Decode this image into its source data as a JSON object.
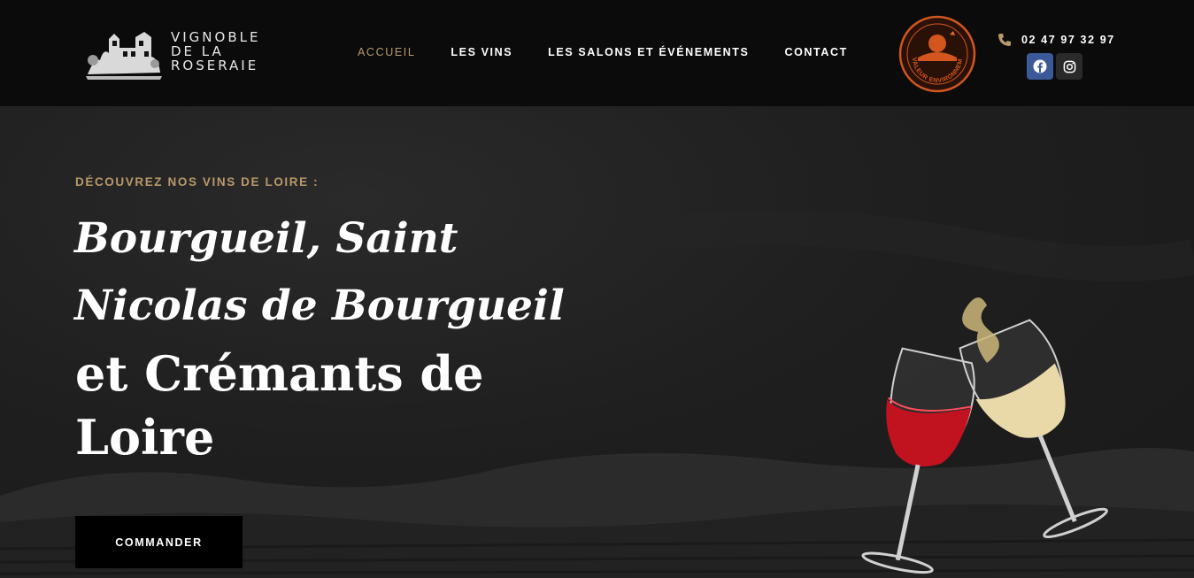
{
  "brand": {
    "name_lines": [
      "VIGNOBLE",
      "DE LA",
      "ROSERAIE"
    ],
    "logo_icon": "chateau-illustration"
  },
  "nav": {
    "items": [
      {
        "label": "ACCUEIL",
        "active": true
      },
      {
        "label": "LES VINS",
        "active": false
      },
      {
        "label": "LES SALONS ET ÉVÉNEMENTS",
        "active": false
      },
      {
        "label": "CONTACT",
        "active": false
      }
    ]
  },
  "certification": {
    "badge_text": "HAUTE VALEUR ENVIRONNEMENTALE",
    "icon": "hve-seal-icon"
  },
  "contact": {
    "phone": "02 47 97 32 97",
    "phone_icon": "phone-icon",
    "socials": [
      {
        "name": "facebook",
        "icon": "facebook-icon",
        "color": "#3b5998"
      },
      {
        "name": "instagram",
        "icon": "instagram-icon",
        "color": "#2a2a2a"
      }
    ]
  },
  "hero": {
    "eyebrow": "DÉCOUVREZ NOS VINS DE LOIRE :",
    "title_italic": "Bourgueil, Saint Nicolas de Bourgueil",
    "title_regular": "et Crémants de Loire",
    "cta_label": "COMMANDER",
    "image": "wine-glasses-toast"
  },
  "colors": {
    "accent_gold": "#b8996a",
    "header_bg": "#0b0b0b",
    "hero_bg": "#1c1c1c",
    "badge_orange": "#d2561e"
  }
}
